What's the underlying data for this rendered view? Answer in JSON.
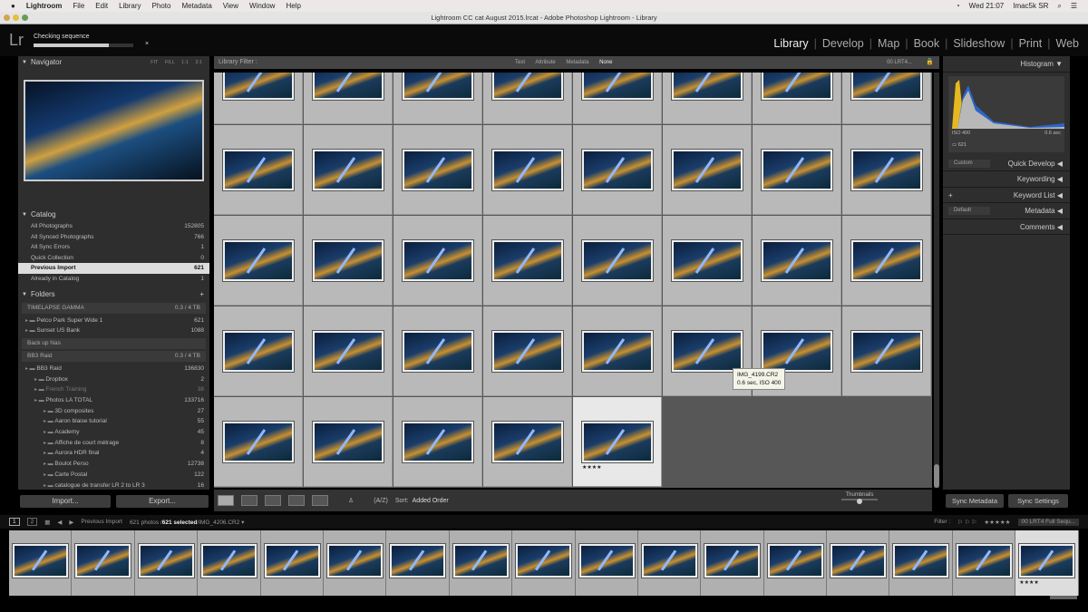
{
  "menubar": {
    "app": "Lightroom",
    "items": [
      "File",
      "Edit",
      "Library",
      "Photo",
      "Metadata",
      "View",
      "Window",
      "Help"
    ],
    "clock": "Wed 21:07",
    "user": "Imac5k SR"
  },
  "window_title": "Lightroom CC cat August 2015.lrcat - Adobe Photoshop Lightroom - Library",
  "logo": "Lr",
  "task": {
    "label": "Checking sequence",
    "progress": 0.75
  },
  "modules": [
    "Library",
    "Develop",
    "Map",
    "Book",
    "Slideshow",
    "Print",
    "Web"
  ],
  "navigator": {
    "title": "Navigator",
    "zoom_opts": [
      "FIT",
      "FILL",
      "1:1",
      "3:1"
    ]
  },
  "catalog": {
    "title": "Catalog",
    "items": [
      {
        "label": "All Photographs",
        "count": "152805"
      },
      {
        "label": "All Synced Photographs",
        "count": "766"
      },
      {
        "label": "All Sync Errors",
        "count": "1"
      },
      {
        "label": "Quick Collection",
        "count": "0"
      },
      {
        "label": "Previous Import",
        "count": "621"
      },
      {
        "label": "Already in Catalog",
        "count": "1"
      }
    ]
  },
  "folders": {
    "title": "Folders",
    "volumes": [
      {
        "name": "TIMELAPSE GAMMA",
        "space": "0.3 / 4 TB",
        "folders": [
          {
            "name": "Petco Park Super Wide 1",
            "count": "621"
          },
          {
            "name": "Sunset US Bank",
            "count": "1088"
          }
        ]
      },
      {
        "name": "Back up Nas",
        "space": ""
      },
      {
        "name": "BB3 Raid",
        "space": "0.3 / 4 TB",
        "folders": [
          {
            "name": "BB3 Raid",
            "count": "136830"
          },
          {
            "name": "Dropbox",
            "count": "2"
          },
          {
            "name": "French Training",
            "count": "38"
          },
          {
            "name": "Photos LA TOTAL",
            "count": "133716"
          },
          {
            "name": "3D composites",
            "count": "27"
          },
          {
            "name": "Aaron blaise tutorial",
            "count": "55"
          },
          {
            "name": "Academy",
            "count": "45"
          },
          {
            "name": "Affiche de court métrage",
            "count": "8"
          },
          {
            "name": "Aurora HDR final",
            "count": "4"
          },
          {
            "name": "Boulot Perso",
            "count": "12738"
          },
          {
            "name": "Carte Postal",
            "count": "122"
          },
          {
            "name": "catalogue de transfer LR 2 to LR 3",
            "count": "16"
          }
        ]
      }
    ]
  },
  "left_buttons": {
    "import": "Import...",
    "export": "Export..."
  },
  "filter_bar": {
    "label": "Library Filter :",
    "options": [
      "Text",
      "Attribute",
      "Metadata",
      "None"
    ],
    "preset": "00 LRT4..."
  },
  "grid": {
    "rows_full": 4,
    "last_row_count": 5,
    "selected_index": 4,
    "selected_rating": "★★★★"
  },
  "tooltip": {
    "filename": "IMG_4199.CR2",
    "info": "0.6 sec, ISO 400"
  },
  "toolbar": {
    "sort_label": "Sort:",
    "sort_value": "Added Order",
    "thumbnails_label": "Thumbnails"
  },
  "histogram": {
    "title": "Histogram",
    "iso": "ISO 400",
    "shutter": "0.6 sec",
    "count": "621"
  },
  "right_panels": [
    {
      "title": "Quick Develop",
      "preset": "Custom"
    },
    {
      "title": "Keywording"
    },
    {
      "title": "Keyword List",
      "plus": "+"
    },
    {
      "title": "Metadata",
      "preset": "Default"
    },
    {
      "title": "Comments"
    }
  ],
  "sync": {
    "metadata": "Sync Metadata",
    "settings": "Sync Settings"
  },
  "statusbar": {
    "pages": [
      "1",
      "2"
    ],
    "source": "Previous Import",
    "photos": "621 photos /",
    "selected": "621 selected",
    "file": "/IMG_4206.CR2 ▾",
    "filter_label": "Filter :",
    "stars": "★★★★★",
    "filter_preset": "00 LRT4 Full Sequ..."
  },
  "filmstrip": {
    "count": 17,
    "selected_rating": "★★★★"
  }
}
